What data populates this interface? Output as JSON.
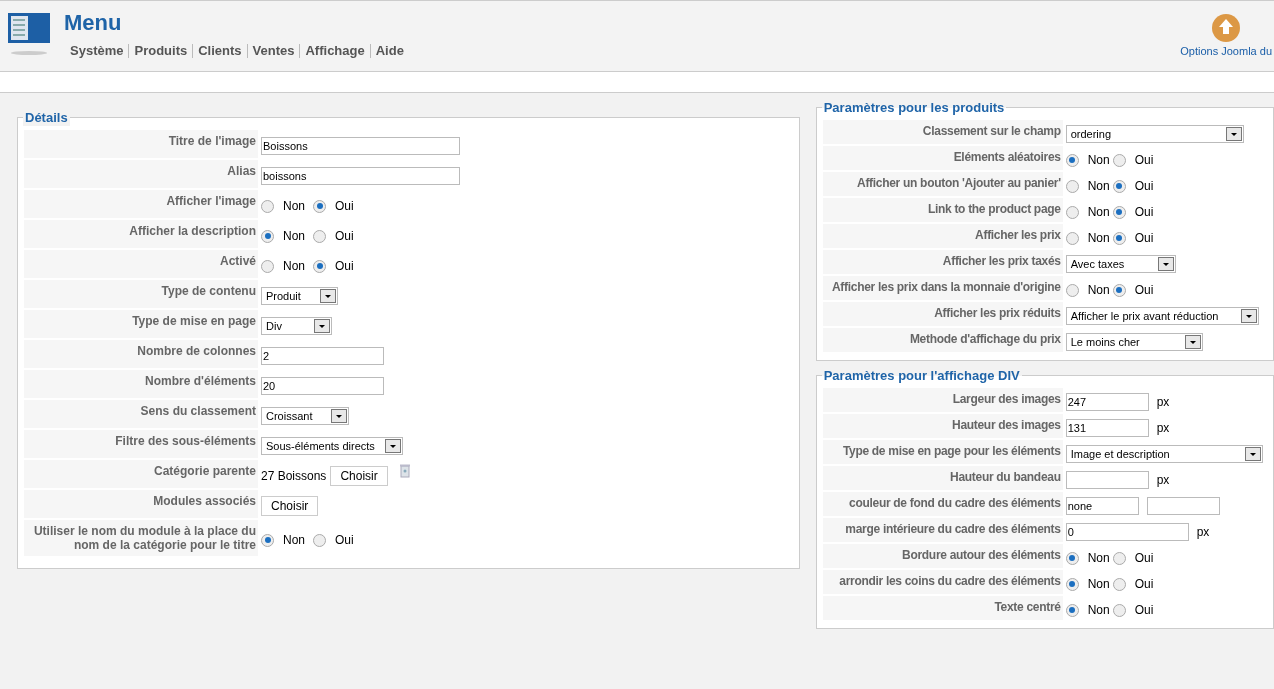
{
  "header": {
    "title": "Menu",
    "nav": [
      "Système",
      "Produits",
      "Clients",
      "Ventes",
      "Affichage",
      "Aide"
    ],
    "options_label": "Options Joomla du"
  },
  "sections": [
    {
      "title": "Détails",
      "rows": [
        {
          "kind": "text",
          "label": "Titre de l'image",
          "value": "Boissons"
        },
        {
          "kind": "text",
          "label": "Alias",
          "value": "boissons"
        },
        {
          "kind": "radio",
          "label": "Afficher l'image",
          "options": [
            {
              "label": "Non",
              "selected": false
            },
            {
              "label": "Oui",
              "selected": true
            }
          ]
        },
        {
          "kind": "radio",
          "label": "Afficher la description",
          "options": [
            {
              "label": "Non",
              "selected": true
            },
            {
              "label": "Oui",
              "selected": false
            }
          ]
        },
        {
          "kind": "radio",
          "label": "Activé",
          "options": [
            {
              "label": "Non",
              "selected": false
            },
            {
              "label": "Oui",
              "selected": true
            }
          ]
        },
        {
          "kind": "select",
          "label": "Type de contenu",
          "value": "Produit"
        },
        {
          "kind": "select",
          "label": "Type de mise en page",
          "value": "Div"
        },
        {
          "kind": "text",
          "label": "Nombre de colonnes",
          "value": "2"
        },
        {
          "kind": "text",
          "label": "Nombre d'éléments",
          "value": "20"
        },
        {
          "kind": "select",
          "label": "Sens du classement",
          "value": "Croissant"
        },
        {
          "kind": "select",
          "label": "Filtre des sous-éléments",
          "value": "Sous-éléments directs"
        },
        {
          "kind": "category",
          "label": "Catégorie parente",
          "value": "27 Boissons",
          "button": "Choisir"
        },
        {
          "kind": "button",
          "label": "Modules associés",
          "button": "Choisir"
        },
        {
          "kind": "radio",
          "label": "Utiliser le nom du module à la place du nom de la catégorie pour le titre",
          "options": [
            {
              "label": "Non",
              "selected": true
            },
            {
              "label": "Oui",
              "selected": false
            }
          ]
        }
      ]
    },
    {
      "title": "Paramètres pour les produits",
      "rows": [
        {
          "kind": "select",
          "label": "Classement sur le champ",
          "value": "ordering"
        },
        {
          "kind": "radio",
          "label": "Eléments aléatoires",
          "options": [
            {
              "label": "Non",
              "selected": true
            },
            {
              "label": "Oui",
              "selected": false
            }
          ]
        },
        {
          "kind": "radio",
          "label": "Afficher un bouton 'Ajouter au panier'",
          "options": [
            {
              "label": "Non",
              "selected": false
            },
            {
              "label": "Oui",
              "selected": true
            }
          ]
        },
        {
          "kind": "radio",
          "label": "Link to the product page",
          "options": [
            {
              "label": "Non",
              "selected": false
            },
            {
              "label": "Oui",
              "selected": true
            }
          ]
        },
        {
          "kind": "radio",
          "label": "Afficher les prix",
          "options": [
            {
              "label": "Non",
              "selected": false
            },
            {
              "label": "Oui",
              "selected": true
            }
          ]
        },
        {
          "kind": "select",
          "label": "Afficher les prix taxés",
          "value": "Avec taxes"
        },
        {
          "kind": "radio",
          "label": "Afficher les prix dans la monnaie d'origine",
          "options": [
            {
              "label": "Non",
              "selected": false
            },
            {
              "label": "Oui",
              "selected": true
            }
          ]
        },
        {
          "kind": "select",
          "label": "Afficher les prix réduits",
          "value": "Afficher le prix avant réduction"
        },
        {
          "kind": "select",
          "label": "Methode d'affichage du prix",
          "value": "Le moins cher"
        }
      ]
    },
    {
      "title": "Paramètres pour l'affichage DIV",
      "rows": [
        {
          "kind": "text",
          "label": "Largeur des images",
          "value": "247",
          "unit": "px"
        },
        {
          "kind": "text",
          "label": "Hauteur des images",
          "value": "131",
          "unit": "px"
        },
        {
          "kind": "select",
          "label": "Type de mise en page pour les éléments",
          "value": "Image et description"
        },
        {
          "kind": "text",
          "label": "Hauteur du bandeau",
          "unit": "px"
        },
        {
          "kind": "color",
          "label": "couleur de fond du cadre des éléments",
          "value": "none"
        },
        {
          "kind": "text",
          "label": "marge intérieure du cadre des éléments",
          "value": "0",
          "unit": "px"
        },
        {
          "kind": "radio",
          "label": "Bordure autour des éléments",
          "options": [
            {
              "label": "Non",
              "selected": true
            },
            {
              "label": "Oui",
              "selected": false
            }
          ]
        },
        {
          "kind": "radio",
          "label": "arrondir les coins du cadre des éléments",
          "options": [
            {
              "label": "Non",
              "selected": true
            },
            {
              "label": "Oui",
              "selected": false
            }
          ]
        },
        {
          "kind": "radio",
          "label": "Texte centré",
          "options": [
            {
              "label": "Non",
              "selected": true
            },
            {
              "label": "Oui",
              "selected": false
            }
          ]
        }
      ]
    }
  ]
}
